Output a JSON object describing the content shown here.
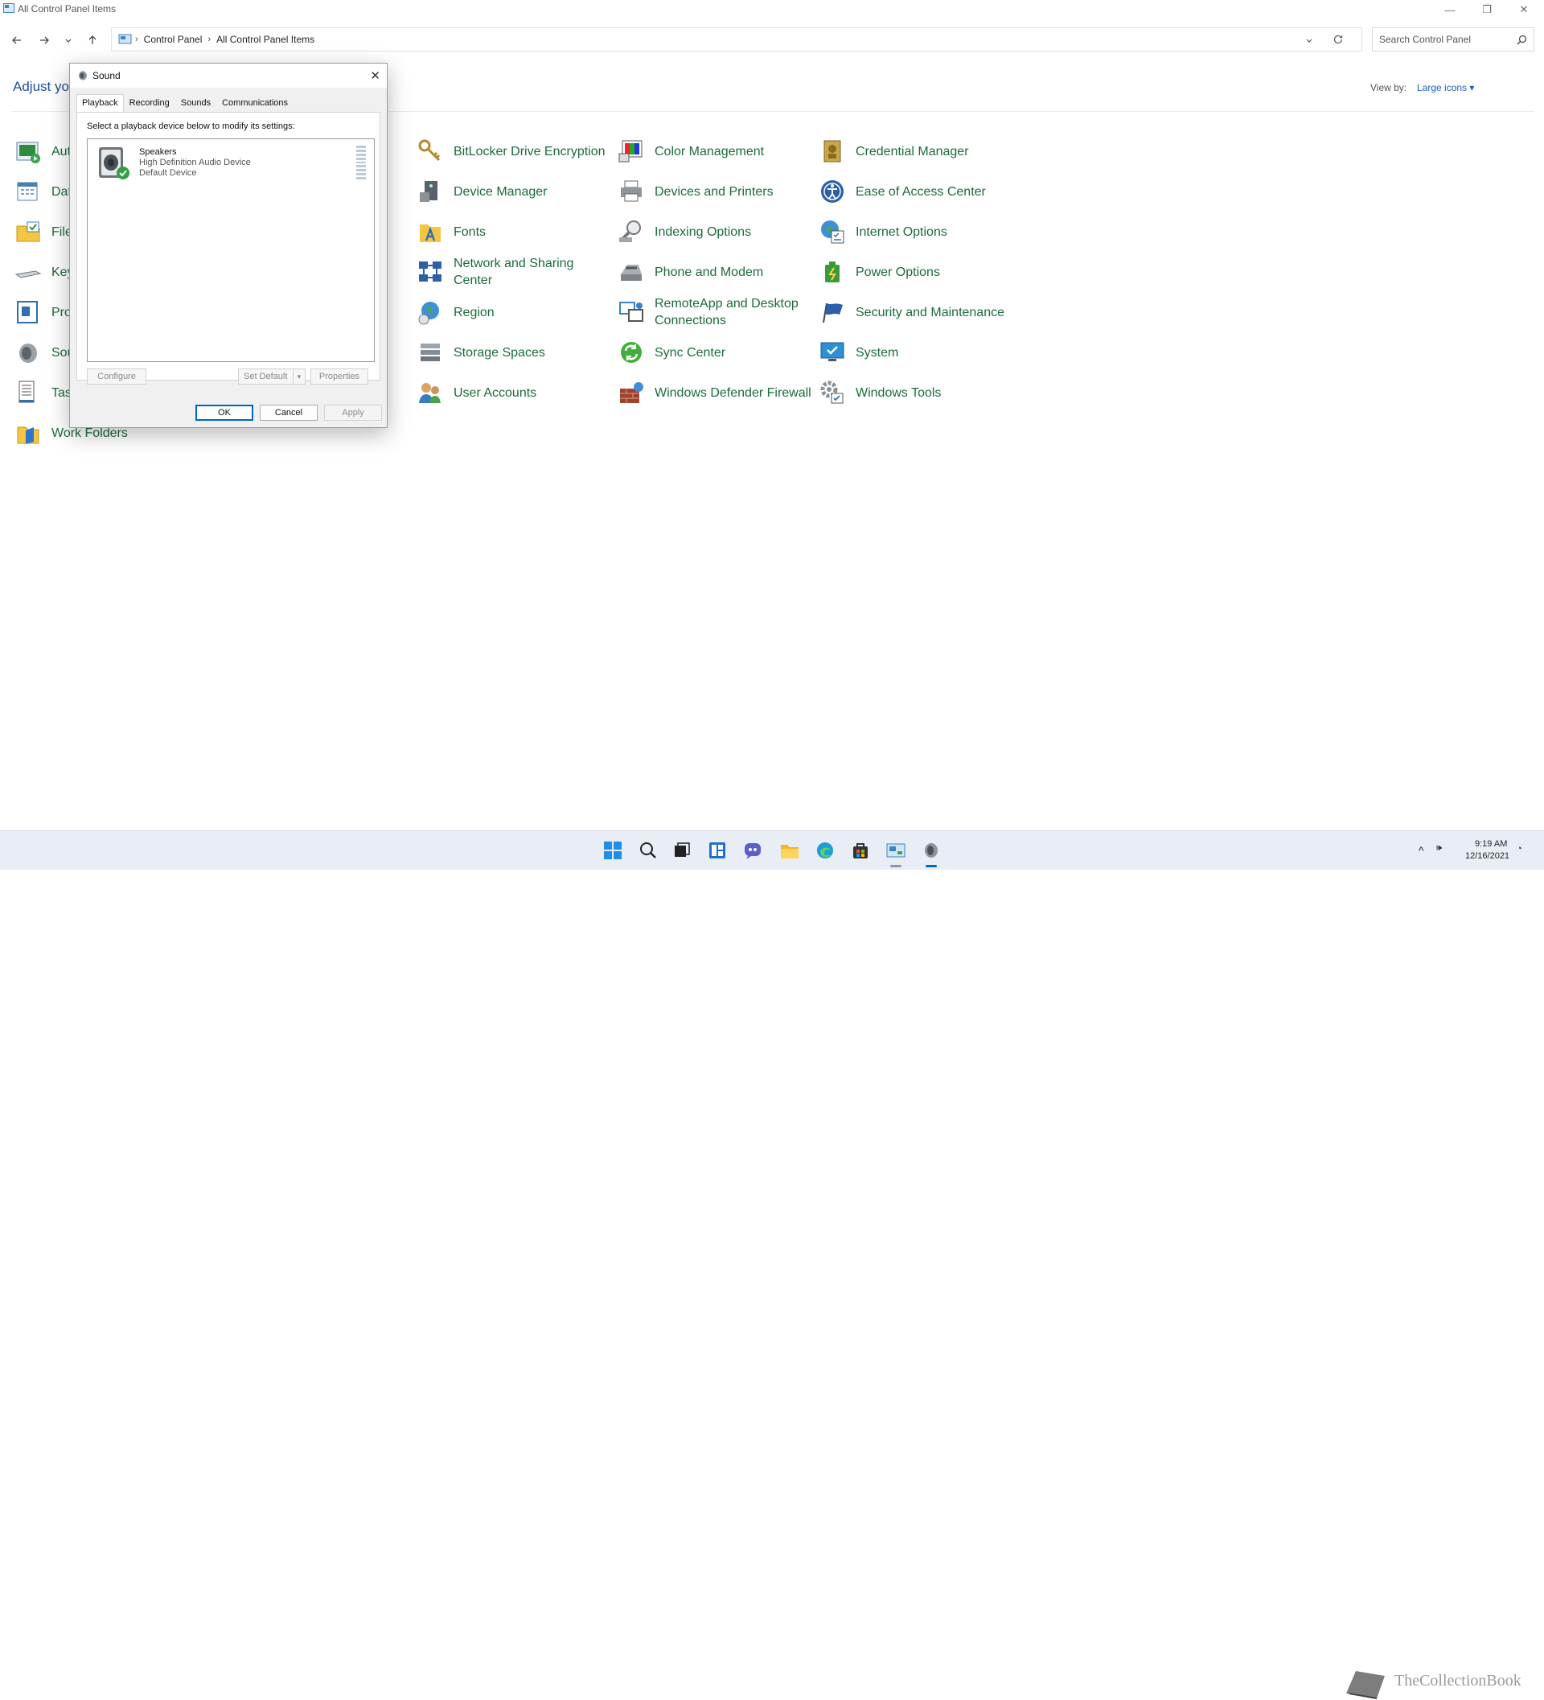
{
  "window": {
    "title": "All Control Panel Items"
  },
  "address": {
    "crumbs": [
      "Control Panel",
      "All Control Panel Items"
    ]
  },
  "search": {
    "placeholder": "Search Control Panel"
  },
  "page": {
    "heading_visible": "Adjust you",
    "viewby_label": "View by:",
    "viewby_value": "Large icons"
  },
  "items_col1_visible": [
    "Aut",
    "Dat",
    "File",
    "Key",
    "Pro",
    "Sou",
    "Task",
    "Work Folders"
  ],
  "items": [
    {
      "label": "BitLocker Drive Encryption",
      "icon": "bitlocker-icon"
    },
    {
      "label": "Color Management",
      "icon": "color-management-icon"
    },
    {
      "label": "Credential Manager",
      "icon": "credential-manager-icon"
    },
    {
      "label": "Device Manager",
      "icon": "device-manager-icon"
    },
    {
      "label": "Devices and Printers",
      "icon": "devices-printers-icon"
    },
    {
      "label": "Ease of Access Center",
      "icon": "ease-of-access-icon"
    },
    {
      "label": "Fonts",
      "icon": "fonts-icon"
    },
    {
      "label": "Indexing Options",
      "icon": "indexing-icon"
    },
    {
      "label": "Internet Options",
      "icon": "internet-options-icon"
    },
    {
      "label": "Network and Sharing Center",
      "icon": "network-icon"
    },
    {
      "label": "Phone and Modem",
      "icon": "phone-modem-icon"
    },
    {
      "label": "Power Options",
      "icon": "power-options-icon"
    },
    {
      "label": "Region",
      "icon": "region-icon"
    },
    {
      "label": "RemoteApp and Desktop Connections",
      "icon": "remoteapp-icon"
    },
    {
      "label": "Security and Maintenance",
      "icon": "security-flag-icon"
    },
    {
      "label": "Storage Spaces",
      "icon": "storage-spaces-icon"
    },
    {
      "label": "Sync Center",
      "icon": "sync-center-icon"
    },
    {
      "label": "System",
      "icon": "system-icon"
    },
    {
      "label": "User Accounts",
      "icon": "user-accounts-icon"
    },
    {
      "label": "Windows Defender Firewall",
      "icon": "firewall-icon"
    },
    {
      "label": "Windows Tools",
      "icon": "windows-tools-icon"
    }
  ],
  "dialog": {
    "title": "Sound",
    "tabs": [
      "Playback",
      "Recording",
      "Sounds",
      "Communications"
    ],
    "instruction": "Select a playback device below to modify its settings:",
    "device": {
      "name": "Speakers",
      "driver": "High Definition Audio Device",
      "status": "Default Device"
    },
    "buttons": {
      "configure": "Configure",
      "set_default": "Set Default",
      "properties": "Properties",
      "ok": "OK",
      "cancel": "Cancel",
      "apply": "Apply"
    }
  },
  "taskbar": {
    "time": "9:19 AM",
    "date": "12/16/2021",
    "watermark": "TheCollectionBook"
  },
  "colors": {
    "link_green": "#1b6b3a",
    "accent": "#0067c0",
    "heading_blue": "#1e4fa2"
  }
}
